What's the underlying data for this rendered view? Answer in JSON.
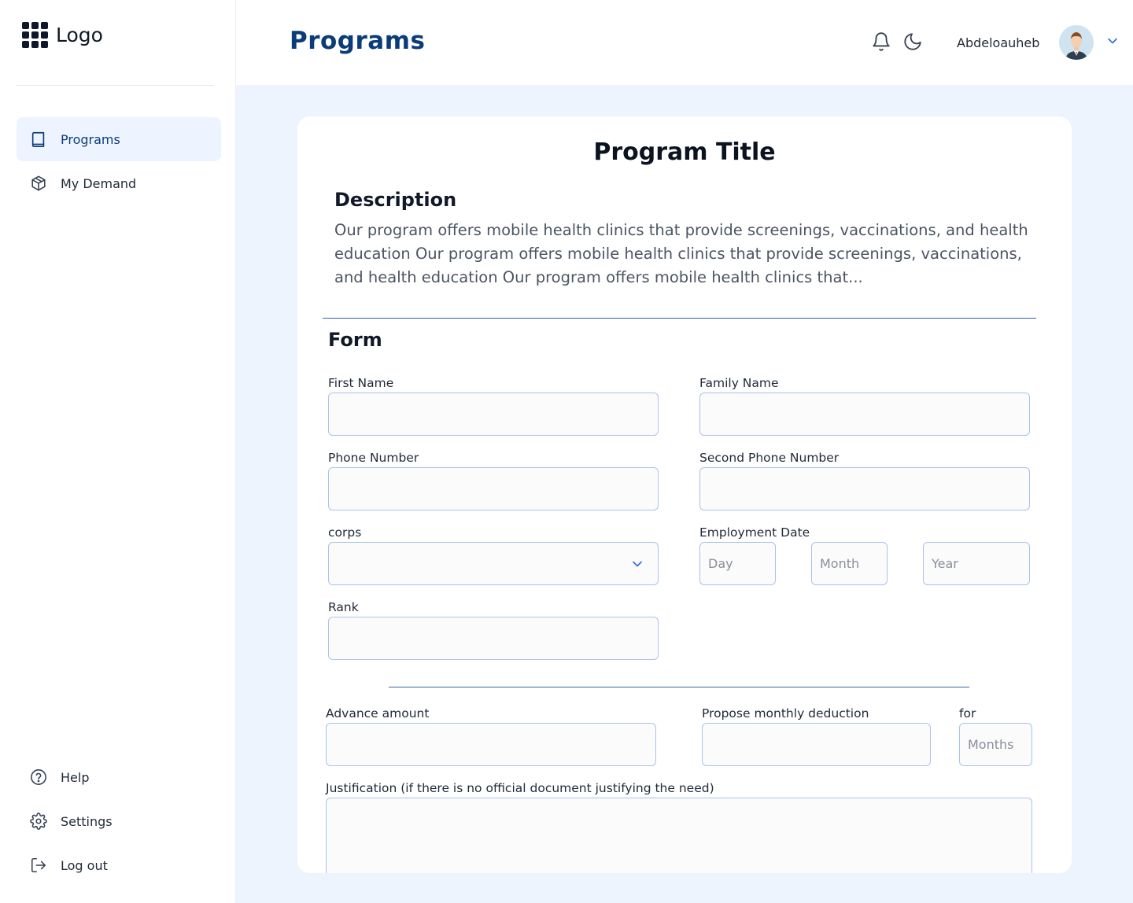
{
  "app": {
    "logo_text": "Logo",
    "page_title": "Programs"
  },
  "sidebar": {
    "items": [
      {
        "label": "Programs",
        "icon": "book-icon",
        "active": true
      },
      {
        "label": "My Demand",
        "icon": "package-icon",
        "active": false
      }
    ],
    "bottom_items": [
      {
        "label": "Help",
        "icon": "help-circle-icon"
      },
      {
        "label": "Settings",
        "icon": "gear-icon"
      },
      {
        "label": "Log out",
        "icon": "logout-icon"
      }
    ]
  },
  "header": {
    "user_name": "Abdeloauheb",
    "icons": [
      "bell-icon",
      "moon-icon",
      "chevron-down-icon"
    ]
  },
  "program": {
    "title": "Program Title",
    "description_label": "Description",
    "description": "Our program offers mobile health clinics that provide screenings, vaccinations, and health education Our program offers mobile health clinics that provide screenings, vaccinations, and health education Our program offers mobile health clinics that..."
  },
  "form": {
    "title": "Form",
    "first_name": {
      "label": "First Name",
      "value": ""
    },
    "family_name": {
      "label": "Family Name",
      "value": ""
    },
    "phone": {
      "label": "Phone Number",
      "value": ""
    },
    "second_phone": {
      "label": "Second Phone Number",
      "value": ""
    },
    "corps": {
      "label": "corps",
      "value": ""
    },
    "employment_date": {
      "label": "Employment Date",
      "day_placeholder": "Day",
      "month_placeholder": "Month",
      "year_placeholder": "Year"
    },
    "rank": {
      "label": "Rank",
      "value": ""
    },
    "advance_amount": {
      "label": "Advance amount",
      "value": ""
    },
    "monthly_deduction": {
      "label": "Propose monthly deduction",
      "value": ""
    },
    "for_label": "for",
    "months_placeholder": "Months",
    "justification": {
      "label": "Justification (if there is no official document justifying the need)",
      "value": ""
    }
  },
  "colors": {
    "brand": "#0b3c7a",
    "accent": "#2f62b3",
    "background": "#eef4fd",
    "active_nav": "#eef4ff"
  }
}
